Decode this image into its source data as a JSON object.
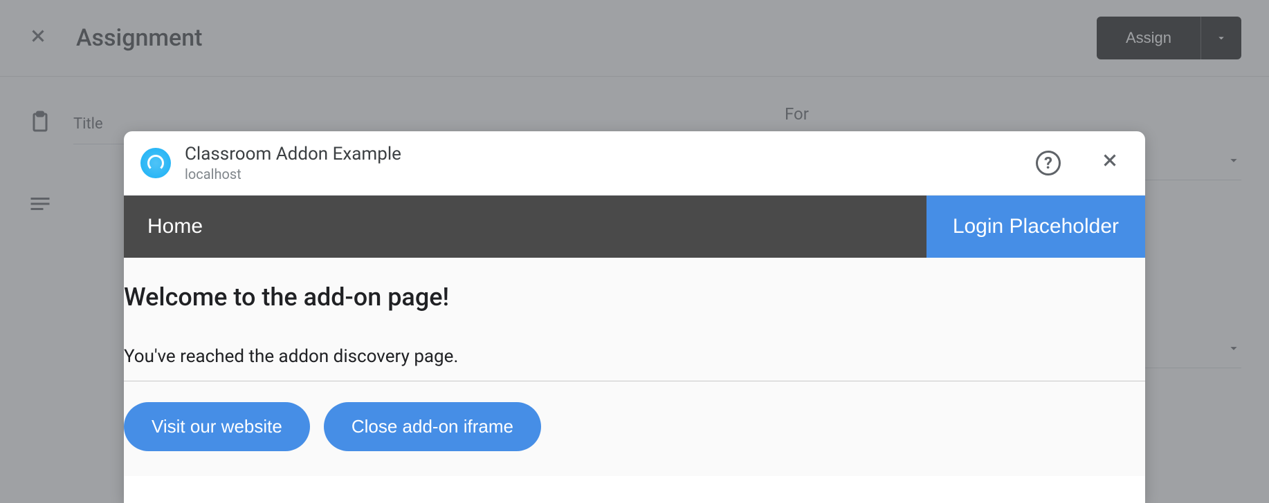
{
  "header": {
    "title": "Assignment",
    "assign_label": "Assign"
  },
  "form": {
    "title_label": "Title",
    "for_label": "For"
  },
  "dialog": {
    "addon_name": "Classroom Addon Example",
    "origin": "localhost",
    "nav": {
      "home": "Home",
      "login": "Login Placeholder"
    },
    "content": {
      "heading": "Welcome to the add-on page!",
      "subtext": "You've reached the addon discovery page.",
      "visit_label": "Visit our website",
      "close_label": "Close add-on iframe"
    }
  }
}
